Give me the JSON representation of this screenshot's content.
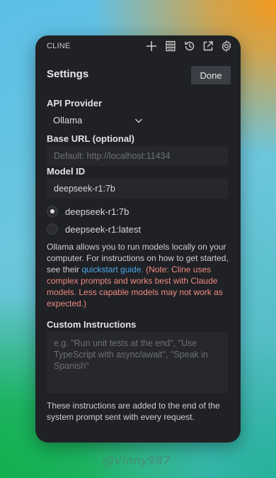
{
  "app": {
    "name": "CLINE"
  },
  "toolbar": {
    "icons": [
      "plus-icon",
      "server-icon",
      "history-icon",
      "external-link-icon",
      "gear-icon"
    ]
  },
  "settings": {
    "title": "Settings",
    "done_label": "Done",
    "api_provider": {
      "label": "API Provider",
      "selected": "Ollama"
    },
    "base_url": {
      "label": "Base URL (optional)",
      "placeholder": "Default: http://localhost:11434",
      "value": ""
    },
    "model_id": {
      "label": "Model ID",
      "value": "deepseek-r1:7b"
    },
    "models": [
      {
        "label": "deepseek-r1:7b",
        "selected": true
      },
      {
        "label": "deepseek-r1:latest",
        "selected": false
      }
    ],
    "description": {
      "text": "Ollama allows you to run models locally on your computer. For instructions on how to get started, see their ",
      "link": "quickstart guide.",
      "warning": "(Note: Cline uses complex prompts and works best with Claude models. Less capable models may not work as expected.)"
    },
    "custom_instructions": {
      "label": "Custom Instructions",
      "placeholder": "e.g. \"Run unit tests at the end\", \"Use TypeScript with async/await\", \"Speak in Spanish\"",
      "value": ""
    },
    "footnote": "These instructions are added to the end of the system prompt sent with every request."
  },
  "watermark": "@Vinny987",
  "colors": {
    "panel_bg": "#1f2125",
    "input_bg": "#26282c",
    "link": "#4ea8e6",
    "warning": "#ef8a80",
    "button_bg": "#3b3e44"
  }
}
